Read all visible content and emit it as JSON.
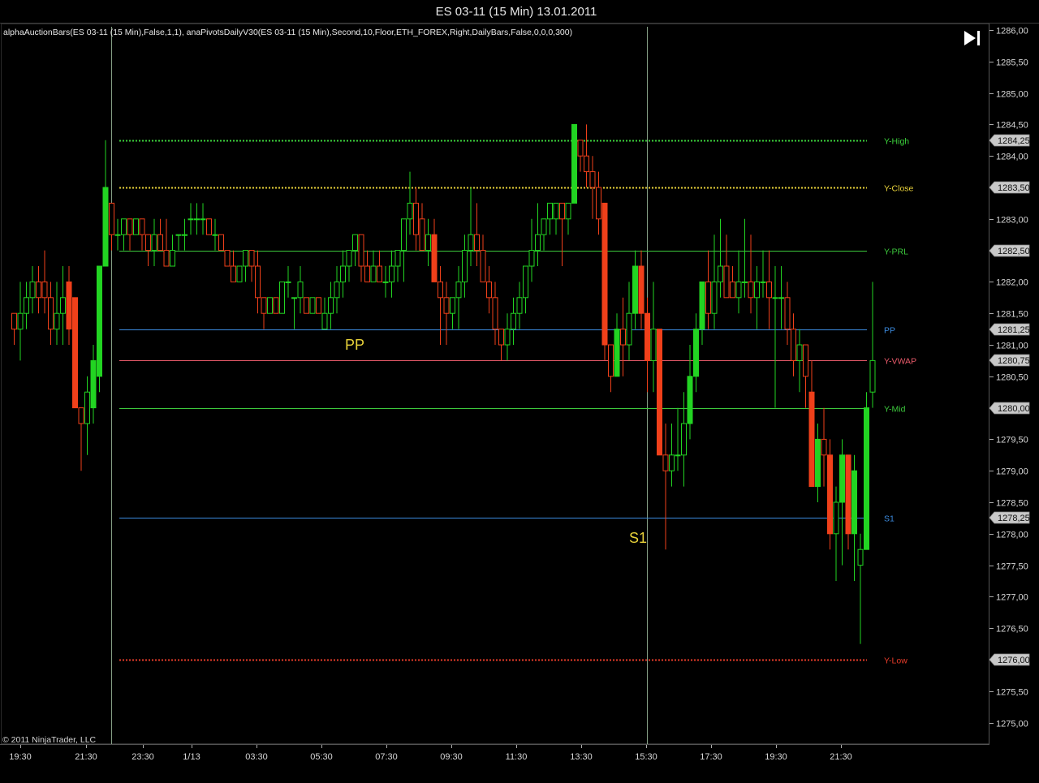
{
  "window_title": "ES 03-11 (15 Min)  13.01.2011",
  "indicator_text": "alphaAuctionBars(ES 03-11 (15 Min),False,1,1), anaPivotsDailyV30(ES 03-11 (15 Min),Second,10,Floor,ETH_FOREX,Right,DailyBars,False,0,0,0,300)",
  "copyright": "© 2011 NinjaTrader, LLC",
  "scroll_end_icon": "skip-to-end-icon",
  "annotations": {
    "pp": "PP",
    "s1": "S1"
  },
  "colors": {
    "background": "#000000",
    "bull": "#22d422",
    "bear": "#f0401a",
    "white": "#ffffff",
    "axis": "#d8d8d8",
    "label_yellow": "#e8d23a"
  },
  "chart_data": {
    "type": "candlestick",
    "title": "ES 03-11 (15 Min)  13.01.2011",
    "y_range": [
      1274.75,
      1286.25
    ],
    "y_ticks": [
      "1286,00",
      "1285,50",
      "1285,00",
      "1284,50",
      "1284,00",
      "1283,50",
      "1283,00",
      "1282,50",
      "1282,00",
      "1281,50",
      "1281,00",
      "1280,50",
      "1280,00",
      "1279,50",
      "1279,00",
      "1278,50",
      "1278,00",
      "1277,50",
      "1277,00",
      "1276,50",
      "1276,00",
      "1275,50",
      "1275,00"
    ],
    "x_ticks": [
      "19:30",
      "21:30",
      "23:30",
      "1/13",
      "03:30",
      "05:30",
      "07:30",
      "09:30",
      "11:30",
      "13:30",
      "15:30",
      "17:30",
      "19:30",
      "21:30"
    ],
    "session_dividers": [
      "22:00",
      "15:15"
    ],
    "levels": [
      {
        "name": "Y-High",
        "value": 1284.25,
        "color": "#3cd23c",
        "style": "dotted",
        "badge": "1284,25"
      },
      {
        "name": "Y-Close",
        "value": 1283.5,
        "color": "#e8d23a",
        "style": "dotted",
        "badge": "1283,50"
      },
      {
        "name": "Y-PRL",
        "value": 1282.5,
        "color": "#3cc83c",
        "style": "solid",
        "badge": "1282,50"
      },
      {
        "name": "PP",
        "value": 1281.25,
        "color": "#3c8ce0",
        "style": "solid",
        "badge": "1281,25"
      },
      {
        "name": "Y-VWAP",
        "value": 1280.75,
        "color": "#e85a6a",
        "style": "solid",
        "badge": "1280,75"
      },
      {
        "name": "Y-Mid",
        "value": 1280.0,
        "color": "#3cc83c",
        "style": "solid",
        "badge": "1280,00"
      },
      {
        "name": "S1",
        "value": 1278.25,
        "color": "#3c8ce0",
        "style": "solid",
        "badge": "1278,25"
      },
      {
        "name": "Y-Low",
        "value": 1276.0,
        "color": "#e83c2a",
        "style": "dotted",
        "badge": "1276,00"
      }
    ],
    "candles": [
      [
        1281.5,
        1281.5,
        1281.0,
        1281.25
      ],
      [
        1281.25,
        1282.0,
        1280.75,
        1281.5
      ],
      [
        1281.5,
        1282.0,
        1281.25,
        1281.75
      ],
      [
        1281.75,
        1282.25,
        1281.5,
        1282.0
      ],
      [
        1282.0,
        1282.25,
        1281.5,
        1281.75
      ],
      [
        1282.0,
        1282.5,
        1281.5,
        1281.75
      ],
      [
        1281.75,
        1282.0,
        1281.0,
        1281.25
      ],
      [
        1281.25,
        1282.0,
        1281.0,
        1281.5
      ],
      [
        1281.5,
        1282.25,
        1281.0,
        1281.75
      ],
      [
        1282.0,
        1282.25,
        1281.0,
        1281.25
      ],
      [
        1281.75,
        1281.75,
        1280.0,
        1280.0
      ],
      [
        1280.0,
        1280.0,
        1279.0,
        1279.75
      ],
      [
        1279.75,
        1280.5,
        1279.25,
        1280.25
      ],
      [
        1280.0,
        1281.0,
        1279.75,
        1280.75
      ],
      [
        1280.5,
        1282.25,
        1280.25,
        1282.25
      ],
      [
        1282.25,
        1284.25,
        1282.25,
        1283.5
      ],
      [
        1283.25,
        1283.25,
        1282.5,
        1282.75
      ],
      [
        1282.75,
        1283.0,
        1282.5,
        1282.75
      ],
      [
        1282.75,
        1283.0,
        1282.5,
        1283.0
      ],
      [
        1283.0,
        1283.0,
        1282.5,
        1282.75
      ],
      [
        1282.75,
        1283.0,
        1282.75,
        1283.0
      ],
      [
        1283.0,
        1283.0,
        1282.5,
        1282.75
      ],
      [
        1282.75,
        1282.75,
        1282.25,
        1282.5
      ],
      [
        1282.5,
        1283.0,
        1282.25,
        1282.75
      ],
      [
        1282.75,
        1283.0,
        1282.5,
        1282.5
      ],
      [
        1282.5,
        1283.0,
        1282.25,
        1282.25
      ],
      [
        1282.25,
        1282.75,
        1282.25,
        1282.5
      ],
      [
        1282.75,
        1282.75,
        1282.5,
        1282.75
      ],
      [
        1282.75,
        1283.0,
        1282.5,
        1282.75
      ],
      [
        1283.0,
        1283.25,
        1282.75,
        1283.0
      ],
      [
        1283.0,
        1283.25,
        1282.75,
        1283.0
      ],
      [
        1283.0,
        1283.25,
        1282.75,
        1283.0
      ],
      [
        1283.0,
        1283.0,
        1282.75,
        1282.75
      ],
      [
        1282.75,
        1283.0,
        1282.5,
        1282.75
      ],
      [
        1282.75,
        1282.75,
        1282.5,
        1282.5
      ],
      [
        1282.5,
        1282.5,
        1282.25,
        1282.25
      ],
      [
        1282.25,
        1282.5,
        1282.0,
        1282.0
      ],
      [
        1282.0,
        1282.25,
        1282.0,
        1282.25
      ],
      [
        1282.25,
        1282.5,
        1282.0,
        1282.5
      ],
      [
        1282.5,
        1282.5,
        1282.0,
        1282.25
      ],
      [
        1282.25,
        1282.5,
        1281.5,
        1281.75
      ],
      [
        1281.75,
        1281.75,
        1281.25,
        1281.5
      ],
      [
        1281.5,
        1281.75,
        1281.5,
        1281.75
      ],
      [
        1281.75,
        1281.75,
        1281.5,
        1281.5
      ],
      [
        1281.5,
        1281.75,
        1281.5,
        1282.0
      ],
      [
        1282.0,
        1282.25,
        1281.75,
        1282.0
      ],
      [
        1281.75,
        1281.75,
        1281.25,
        1281.75
      ],
      [
        1281.75,
        1282.25,
        1281.5,
        1282.0
      ],
      [
        1281.75,
        1281.75,
        1281.5,
        1281.5
      ],
      [
        1281.5,
        1281.75,
        1281.5,
        1281.75
      ],
      [
        1281.75,
        1281.75,
        1281.5,
        1281.5
      ],
      [
        1281.25,
        1281.75,
        1281.25,
        1281.5
      ],
      [
        1281.5,
        1282.0,
        1281.25,
        1281.75
      ],
      [
        1281.75,
        1282.25,
        1281.5,
        1282.0
      ],
      [
        1282.0,
        1282.5,
        1281.75,
        1282.25
      ],
      [
        1282.25,
        1282.5,
        1282.0,
        1282.5
      ],
      [
        1282.5,
        1282.75,
        1282.25,
        1282.75
      ],
      [
        1282.75,
        1282.75,
        1282.0,
        1282.25
      ],
      [
        1282.25,
        1282.5,
        1282.0,
        1282.0
      ],
      [
        1282.0,
        1282.5,
        1282.0,
        1282.25
      ],
      [
        1282.25,
        1282.5,
        1282.0,
        1282.0
      ],
      [
        1282.0,
        1282.25,
        1281.75,
        1282.0
      ],
      [
        1282.0,
        1282.5,
        1281.75,
        1282.25
      ],
      [
        1282.25,
        1282.5,
        1282.0,
        1282.5
      ],
      [
        1282.5,
        1283.0,
        1282.0,
        1283.0
      ],
      [
        1283.0,
        1283.75,
        1282.75,
        1283.25
      ],
      [
        1283.25,
        1283.5,
        1282.5,
        1282.75
      ],
      [
        1283.0,
        1283.25,
        1282.5,
        1282.5
      ],
      [
        1282.5,
        1283.0,
        1282.25,
        1282.75
      ],
      [
        1282.75,
        1283.0,
        1282.0,
        1282.0
      ],
      [
        1282.0,
        1282.25,
        1281.0,
        1281.75
      ],
      [
        1281.75,
        1282.0,
        1281.0,
        1281.5
      ],
      [
        1281.5,
        1281.75,
        1281.25,
        1281.75
      ],
      [
        1281.75,
        1282.25,
        1281.25,
        1282.0
      ],
      [
        1282.0,
        1282.75,
        1281.75,
        1282.5
      ],
      [
        1282.5,
        1283.5,
        1282.25,
        1282.75
      ],
      [
        1282.75,
        1283.25,
        1282.25,
        1282.5
      ],
      [
        1282.5,
        1282.75,
        1282.0,
        1282.0
      ],
      [
        1282.0,
        1282.25,
        1281.5,
        1281.75
      ],
      [
        1281.75,
        1282.0,
        1281.0,
        1281.25
      ],
      [
        1281.25,
        1281.25,
        1280.75,
        1281.0
      ],
      [
        1281.0,
        1281.5,
        1280.75,
        1281.25
      ],
      [
        1281.25,
        1281.75,
        1281.0,
        1281.5
      ],
      [
        1281.5,
        1282.0,
        1281.25,
        1281.75
      ],
      [
        1281.75,
        1282.25,
        1281.5,
        1282.25
      ],
      [
        1282.25,
        1283.0,
        1282.0,
        1282.5
      ],
      [
        1282.5,
        1283.25,
        1282.25,
        1282.75
      ],
      [
        1282.75,
        1283.0,
        1282.5,
        1283.0
      ],
      [
        1283.0,
        1283.25,
        1282.75,
        1283.25
      ],
      [
        1283.0,
        1283.25,
        1282.75,
        1283.25
      ],
      [
        1283.25,
        1283.25,
        1282.25,
        1283.0
      ],
      [
        1283.0,
        1283.25,
        1282.75,
        1283.25
      ],
      [
        1283.25,
        1284.5,
        1283.25,
        1284.5
      ],
      [
        1284.25,
        1284.25,
        1283.75,
        1284.0
      ],
      [
        1284.0,
        1284.5,
        1283.5,
        1283.75
      ],
      [
        1283.75,
        1284.0,
        1283.0,
        1283.5
      ],
      [
        1283.5,
        1283.75,
        1282.75,
        1283.0
      ],
      [
        1283.25,
        1283.25,
        1280.75,
        1281.0
      ],
      [
        1281.0,
        1281.0,
        1280.25,
        1280.5
      ],
      [
        1280.5,
        1281.5,
        1280.5,
        1281.25
      ],
      [
        1281.25,
        1281.75,
        1280.5,
        1281.0
      ],
      [
        1281.0,
        1282.0,
        1280.75,
        1281.5
      ],
      [
        1281.5,
        1282.5,
        1281.25,
        1282.25
      ],
      [
        1282.25,
        1282.5,
        1281.25,
        1281.5
      ],
      [
        1281.5,
        1281.75,
        1280.25,
        1280.75
      ],
      [
        1280.75,
        1282.0,
        1280.25,
        1281.25
      ],
      [
        1281.25,
        1281.25,
        1279.25,
        1279.25
      ],
      [
        1279.25,
        1279.75,
        1277.75,
        1279.0
      ],
      [
        1279.0,
        1279.75,
        1278.75,
        1279.25
      ],
      [
        1279.25,
        1280.0,
        1279.0,
        1279.25
      ],
      [
        1279.25,
        1280.25,
        1278.75,
        1279.75
      ],
      [
        1279.75,
        1281.0,
        1279.5,
        1280.5
      ],
      [
        1280.5,
        1281.5,
        1280.25,
        1281.25
      ],
      [
        1281.25,
        1282.0,
        1281.0,
        1282.0
      ],
      [
        1282.0,
        1282.5,
        1281.25,
        1281.5
      ],
      [
        1281.5,
        1282.75,
        1281.25,
        1282.0
      ],
      [
        1282.0,
        1283.0,
        1281.75,
        1282.25
      ],
      [
        1282.25,
        1282.75,
        1281.75,
        1281.75
      ],
      [
        1282.0,
        1282.25,
        1281.75,
        1281.75
      ],
      [
        1281.75,
        1282.5,
        1281.5,
        1282.0
      ],
      [
        1282.0,
        1283.0,
        1281.75,
        1282.0
      ],
      [
        1282.0,
        1282.75,
        1281.5,
        1281.75
      ],
      [
        1281.75,
        1282.25,
        1281.25,
        1282.0
      ],
      [
        1282.0,
        1282.5,
        1281.75,
        1282.0
      ],
      [
        1282.0,
        1282.5,
        1281.25,
        1281.75
      ],
      [
        1281.75,
        1282.25,
        1280.0,
        1281.75
      ],
      [
        1281.75,
        1282.25,
        1281.25,
        1281.75
      ],
      [
        1281.75,
        1282.0,
        1281.0,
        1281.25
      ],
      [
        1281.25,
        1281.5,
        1280.5,
        1280.75
      ],
      [
        1280.75,
        1281.25,
        1280.25,
        1281.0
      ],
      [
        1281.0,
        1281.0,
        1280.0,
        1280.5
      ],
      [
        1280.25,
        1280.75,
        1278.75,
        1278.75
      ],
      [
        1278.75,
        1279.75,
        1278.5,
        1279.5
      ],
      [
        1279.5,
        1280.0,
        1278.75,
        1279.25
      ],
      [
        1279.25,
        1279.5,
        1277.75,
        1278.0
      ],
      [
        1278.0,
        1278.75,
        1277.25,
        1278.5
      ],
      [
        1278.5,
        1279.5,
        1277.5,
        1279.25
      ],
      [
        1279.25,
        1279.25,
        1277.75,
        1278.0
      ],
      [
        1278.0,
        1279.25,
        1277.25,
        1279.0
      ],
      [
        1277.5,
        1278.0,
        1276.25,
        1277.75
      ],
      [
        1277.75,
        1280.25,
        1277.75,
        1280.0
      ],
      [
        1280.25,
        1282.0,
        1280.0,
        1280.75
      ]
    ]
  }
}
